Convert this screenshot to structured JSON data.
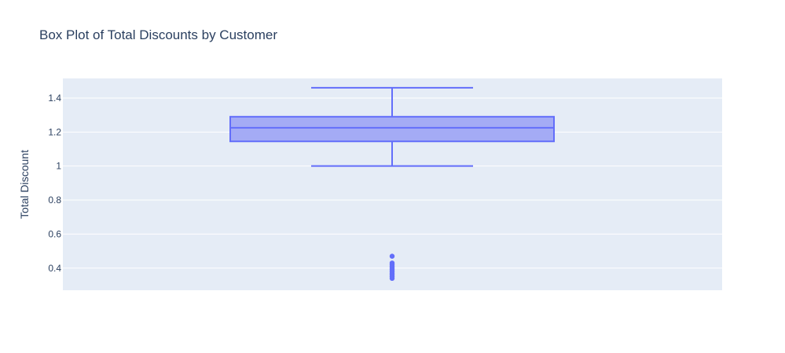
{
  "chart_data": {
    "type": "box",
    "title": "Box Plot of Total Discounts by Customer",
    "xlabel": "",
    "ylabel": "Total Discount",
    "ylim": [
      0.27,
      1.515
    ],
    "yticks": [
      0.4,
      0.6,
      0.8,
      1.0,
      1.2,
      1.4
    ],
    "ytick_labels": [
      "0.4",
      "0.6",
      "0.8",
      "1",
      "1.2",
      "1.4"
    ],
    "grid": true,
    "legend": "none",
    "box": {
      "min": 1.0,
      "q1": 1.145,
      "median": 1.225,
      "q3": 1.29,
      "max": 1.46
    },
    "outliers": [
      0.47,
      0.43,
      0.42,
      0.41,
      0.4,
      0.39,
      0.38,
      0.37,
      0.36,
      0.35,
      0.34
    ],
    "colors": {
      "plot_bg": "#e5ecf6",
      "grid": "#ffffff",
      "box_line": "#636efa",
      "box_fill": "#a4abf5",
      "marker": "#636efa",
      "text": "#2a3f5f"
    }
  }
}
